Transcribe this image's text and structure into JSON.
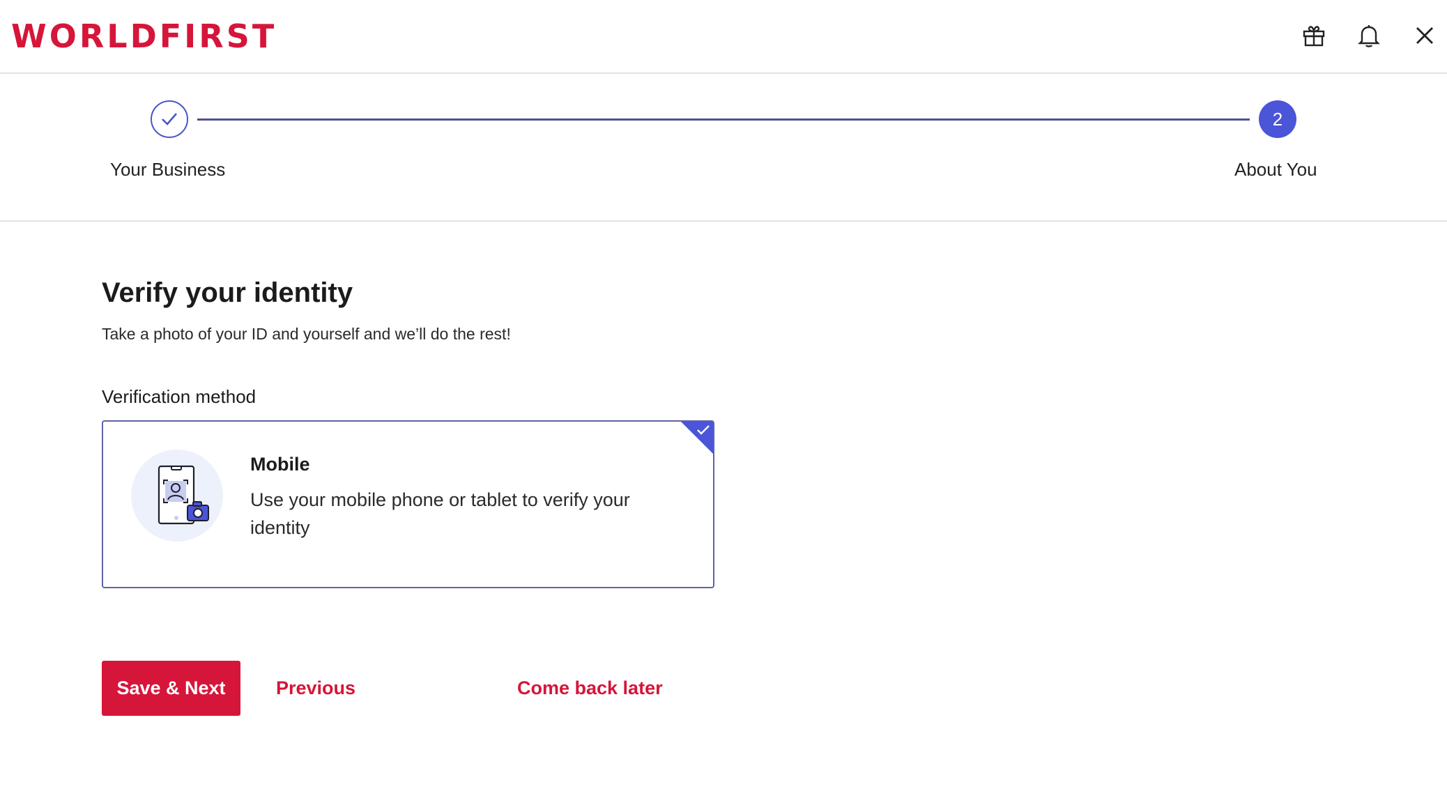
{
  "header": {
    "logo_text": "WORLDFIRST",
    "icons": [
      "gift-icon",
      "bell-icon",
      "close-icon"
    ],
    "brand_color": "#d6153a"
  },
  "stepper": {
    "steps": [
      {
        "label": "Your Business",
        "status": "completed"
      },
      {
        "label": "About You",
        "status": "active",
        "number": "2"
      }
    ],
    "accent_color": "#4a55d8"
  },
  "main": {
    "title": "Verify your identity",
    "subtitle": "Take a photo of your ID and yourself and we’ll do the rest!",
    "section_label": "Verification method",
    "methods": [
      {
        "title": "Mobile",
        "description": "Use your mobile phone or tablet to verify your identity",
        "selected": true,
        "icon": "mobile-camera-illustration"
      }
    ]
  },
  "actions": {
    "primary_label": "Save & Next",
    "previous_label": "Previous",
    "later_label": "Come back later"
  }
}
